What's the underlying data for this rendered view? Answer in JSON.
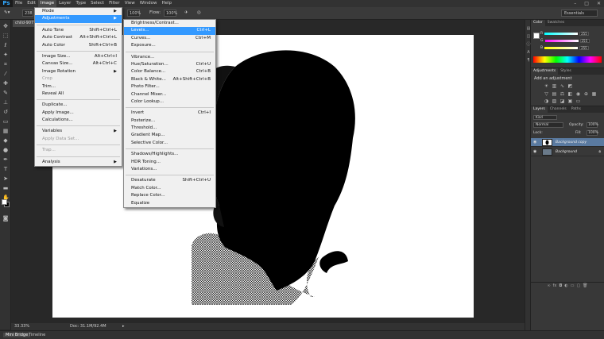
{
  "app": {
    "logo": "Ps"
  },
  "menubar": {
    "items": [
      "File",
      "Edit",
      "Image",
      "Layer",
      "Type",
      "Select",
      "Filter",
      "View",
      "Window",
      "Help"
    ],
    "active_index": 2,
    "window_buttons": [
      "–",
      "□",
      "✕"
    ]
  },
  "options_bar": {
    "size_value": "238",
    "opacity_value": "100%",
    "flow_label": "Flow:",
    "flow_value": "100%",
    "workspace": "Essentials"
  },
  "document": {
    "tab_label": "child-9071...",
    "zoom": "33.33%",
    "doc_info": "Doc: 31.1M/92.4M"
  },
  "image_menu": {
    "items": [
      {
        "label": "Mode",
        "shortcut": "",
        "submenu": true,
        "disabled": false
      },
      {
        "label": "Adjustments",
        "shortcut": "",
        "submenu": true,
        "disabled": false,
        "highlighted": true
      },
      {
        "sep": true
      },
      {
        "label": "Auto Tone",
        "shortcut": "Shift+Ctrl+L"
      },
      {
        "label": "Auto Contrast",
        "shortcut": "Alt+Shift+Ctrl+L"
      },
      {
        "label": "Auto Color",
        "shortcut": "Shift+Ctrl+B"
      },
      {
        "sep": true
      },
      {
        "label": "Image Size...",
        "shortcut": "Alt+Ctrl+I"
      },
      {
        "label": "Canvas Size...",
        "shortcut": "Alt+Ctrl+C"
      },
      {
        "label": "Image Rotation",
        "shortcut": "",
        "submenu": true
      },
      {
        "label": "Crop",
        "shortcut": "",
        "disabled": true
      },
      {
        "label": "Trim...",
        "shortcut": ""
      },
      {
        "label": "Reveal All",
        "shortcut": ""
      },
      {
        "sep": true
      },
      {
        "label": "Duplicate...",
        "shortcut": ""
      },
      {
        "label": "Apply Image...",
        "shortcut": ""
      },
      {
        "label": "Calculations...",
        "shortcut": ""
      },
      {
        "sep": true
      },
      {
        "label": "Variables",
        "shortcut": "",
        "submenu": true
      },
      {
        "label": "Apply Data Set...",
        "shortcut": "",
        "disabled": true
      },
      {
        "sep": true
      },
      {
        "label": "Trap...",
        "shortcut": "",
        "disabled": true
      },
      {
        "sep": true
      },
      {
        "label": "Analysis",
        "shortcut": "",
        "submenu": true
      }
    ]
  },
  "adjustments_menu": {
    "items": [
      {
        "label": "Brightness/Contrast...",
        "shortcut": ""
      },
      {
        "label": "Levels...",
        "shortcut": "Ctrl+L",
        "highlighted": true
      },
      {
        "label": "Curves...",
        "shortcut": "Ctrl+M"
      },
      {
        "label": "Exposure...",
        "shortcut": ""
      },
      {
        "sep": true
      },
      {
        "label": "Vibrance...",
        "shortcut": ""
      },
      {
        "label": "Hue/Saturation...",
        "shortcut": "Ctrl+U"
      },
      {
        "label": "Color Balance...",
        "shortcut": "Ctrl+B"
      },
      {
        "label": "Black & White...",
        "shortcut": "Alt+Shift+Ctrl+B"
      },
      {
        "label": "Photo Filter...",
        "shortcut": ""
      },
      {
        "label": "Channel Mixer...",
        "shortcut": ""
      },
      {
        "label": "Color Lookup...",
        "shortcut": ""
      },
      {
        "sep": true
      },
      {
        "label": "Invert",
        "shortcut": "Ctrl+I"
      },
      {
        "label": "Posterize...",
        "shortcut": ""
      },
      {
        "label": "Threshold...",
        "shortcut": ""
      },
      {
        "label": "Gradient Map...",
        "shortcut": ""
      },
      {
        "label": "Selective Color...",
        "shortcut": ""
      },
      {
        "sep": true
      },
      {
        "label": "Shadows/Highlights...",
        "shortcut": ""
      },
      {
        "label": "HDR Toning...",
        "shortcut": ""
      },
      {
        "label": "Variations...",
        "shortcut": ""
      },
      {
        "sep": true
      },
      {
        "label": "Desaturate",
        "shortcut": "Shift+Ctrl+U"
      },
      {
        "label": "Match Color...",
        "shortcut": ""
      },
      {
        "label": "Replace Color...",
        "shortcut": ""
      },
      {
        "label": "Equalize",
        "shortcut": ""
      }
    ]
  },
  "color_panel": {
    "tabs": [
      "Color",
      "Swatches"
    ],
    "rows": [
      {
        "channel": "R",
        "value": "255"
      },
      {
        "channel": "G",
        "value": "255"
      },
      {
        "channel": "B",
        "value": "255"
      }
    ]
  },
  "adjustments_panel": {
    "tabs": [
      "Adjustments",
      "Styles"
    ],
    "title": "Add an adjustment"
  },
  "layers_panel": {
    "tabs": [
      "Layers",
      "Channels",
      "Paths"
    ],
    "filter": "Kind",
    "blend_mode": "Normal",
    "opacity_label": "Opacity:",
    "opacity_value": "100%",
    "lock_label": "Lock:",
    "fill_label": "Fill:",
    "fill_value": "100%",
    "layers": [
      {
        "name": "Background copy",
        "selected": true
      },
      {
        "name": "Background",
        "selected": false
      }
    ]
  },
  "bottom_tabs": [
    "Mini Bridge",
    "Timeline"
  ]
}
